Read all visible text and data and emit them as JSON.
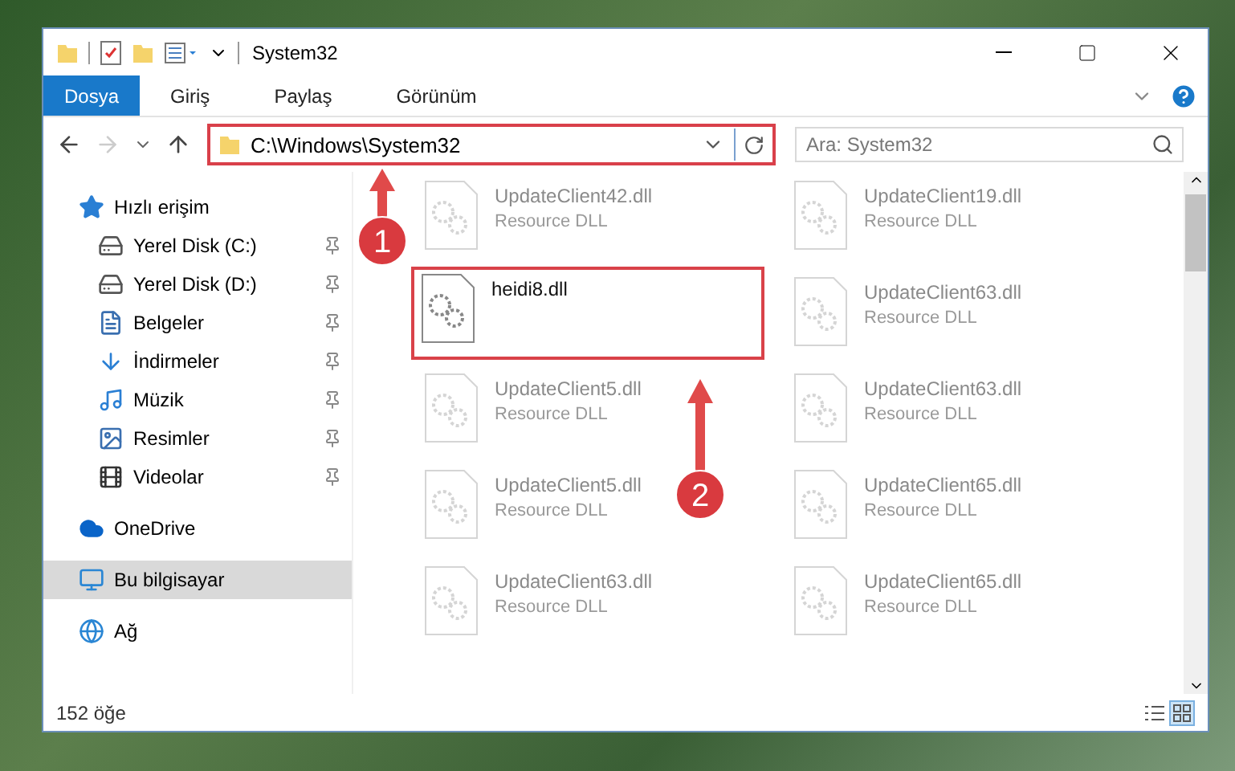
{
  "window": {
    "title": "System32"
  },
  "ribbon_tabs": [
    {
      "label": "Dosya",
      "selected": true
    },
    {
      "label": "Giriş",
      "selected": false
    },
    {
      "label": "Paylaş",
      "selected": false
    },
    {
      "label": "Görünüm",
      "selected": false
    }
  ],
  "navigation": {
    "back_disabled": false,
    "forward_disabled": true
  },
  "address": {
    "value": "C:\\Windows\\System32"
  },
  "search": {
    "placeholder": "Ara: System32"
  },
  "sidebar": {
    "items": [
      {
        "label": "Hızlı erişim",
        "kind": "star",
        "selected": false,
        "children": [
          {
            "label": "Yerel Disk (C:)",
            "kind": "drive",
            "pinned": true,
            "selected": false
          },
          {
            "label": "Yerel Disk (D:)",
            "kind": "drive",
            "pinned": true,
            "selected": false
          },
          {
            "label": "Belgeler",
            "kind": "document",
            "pinned": true,
            "selected": false
          },
          {
            "label": "İndirmeler",
            "kind": "download",
            "pinned": true,
            "selected": false
          },
          {
            "label": "Müzik",
            "kind": "music",
            "pinned": true,
            "selected": false
          },
          {
            "label": "Resimler",
            "kind": "picture",
            "pinned": true,
            "selected": false
          },
          {
            "label": "Videolar",
            "kind": "video",
            "pinned": true,
            "selected": false
          }
        ]
      },
      {
        "label": "OneDrive",
        "kind": "cloud",
        "selected": false
      },
      {
        "label": "Bu bilgisayar",
        "kind": "computer",
        "selected": true
      },
      {
        "label": "Ağ",
        "kind": "network",
        "selected": false
      }
    ]
  },
  "files": [
    {
      "name": "UpdateClient42.dll",
      "type": "Resource DLL",
      "blurred": true
    },
    {
      "name": "UpdateClient19.dll",
      "type": "Resource DLL",
      "blurred": true
    },
    {
      "name": "heidi8.dll",
      "blurred": false
    },
    {
      "name": "UpdateClient63.dll",
      "type": "Resource DLL",
      "blurred": true
    },
    {
      "name": "UpdateClient5.dll",
      "type": "Resource DLL",
      "blurred": true
    },
    {
      "name": "UpdateClient63.dll",
      "type": "Resource DLL",
      "blurred": true
    },
    {
      "name": "UpdateClient5.dll",
      "type": "Resource DLL",
      "blurred": true
    },
    {
      "name": "UpdateClient65.dll",
      "type": "Resource DLL",
      "blurred": true
    },
    {
      "name": "UpdateClient63.dll",
      "type": "Resource DLL",
      "blurred": true
    },
    {
      "name": "UpdateClient65.dll",
      "type": "Resource DLL",
      "blurred": true
    }
  ],
  "status_bar": {
    "count": "152 öğe",
    "view_buttons": [
      {
        "kind": "details",
        "selected": false
      },
      {
        "kind": "large_icons",
        "selected": true
      }
    ]
  },
  "annotations": [
    {
      "number": "1"
    },
    {
      "number": "2"
    }
  ]
}
